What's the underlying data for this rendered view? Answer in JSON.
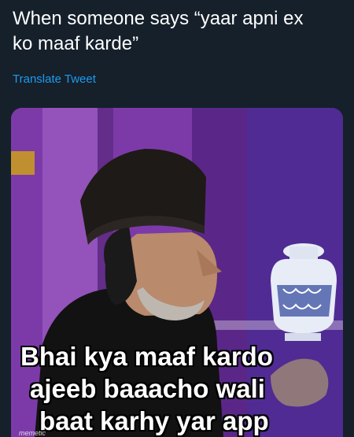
{
  "tweet": {
    "text_line1": "When someone says “yaar apni ex",
    "text_line2": "ko maaf karde”",
    "translate_label": "Translate Tweet"
  },
  "media": {
    "caption_line1": "Bhai kya maaf kardo",
    "caption_line2": "ajeeb baaacho wali",
    "caption_line3": "baat karhy yar app",
    "watermark": "memetic"
  },
  "colors": {
    "background": "#15202b",
    "text": "#ffffff",
    "link": "#1d9bf0"
  }
}
